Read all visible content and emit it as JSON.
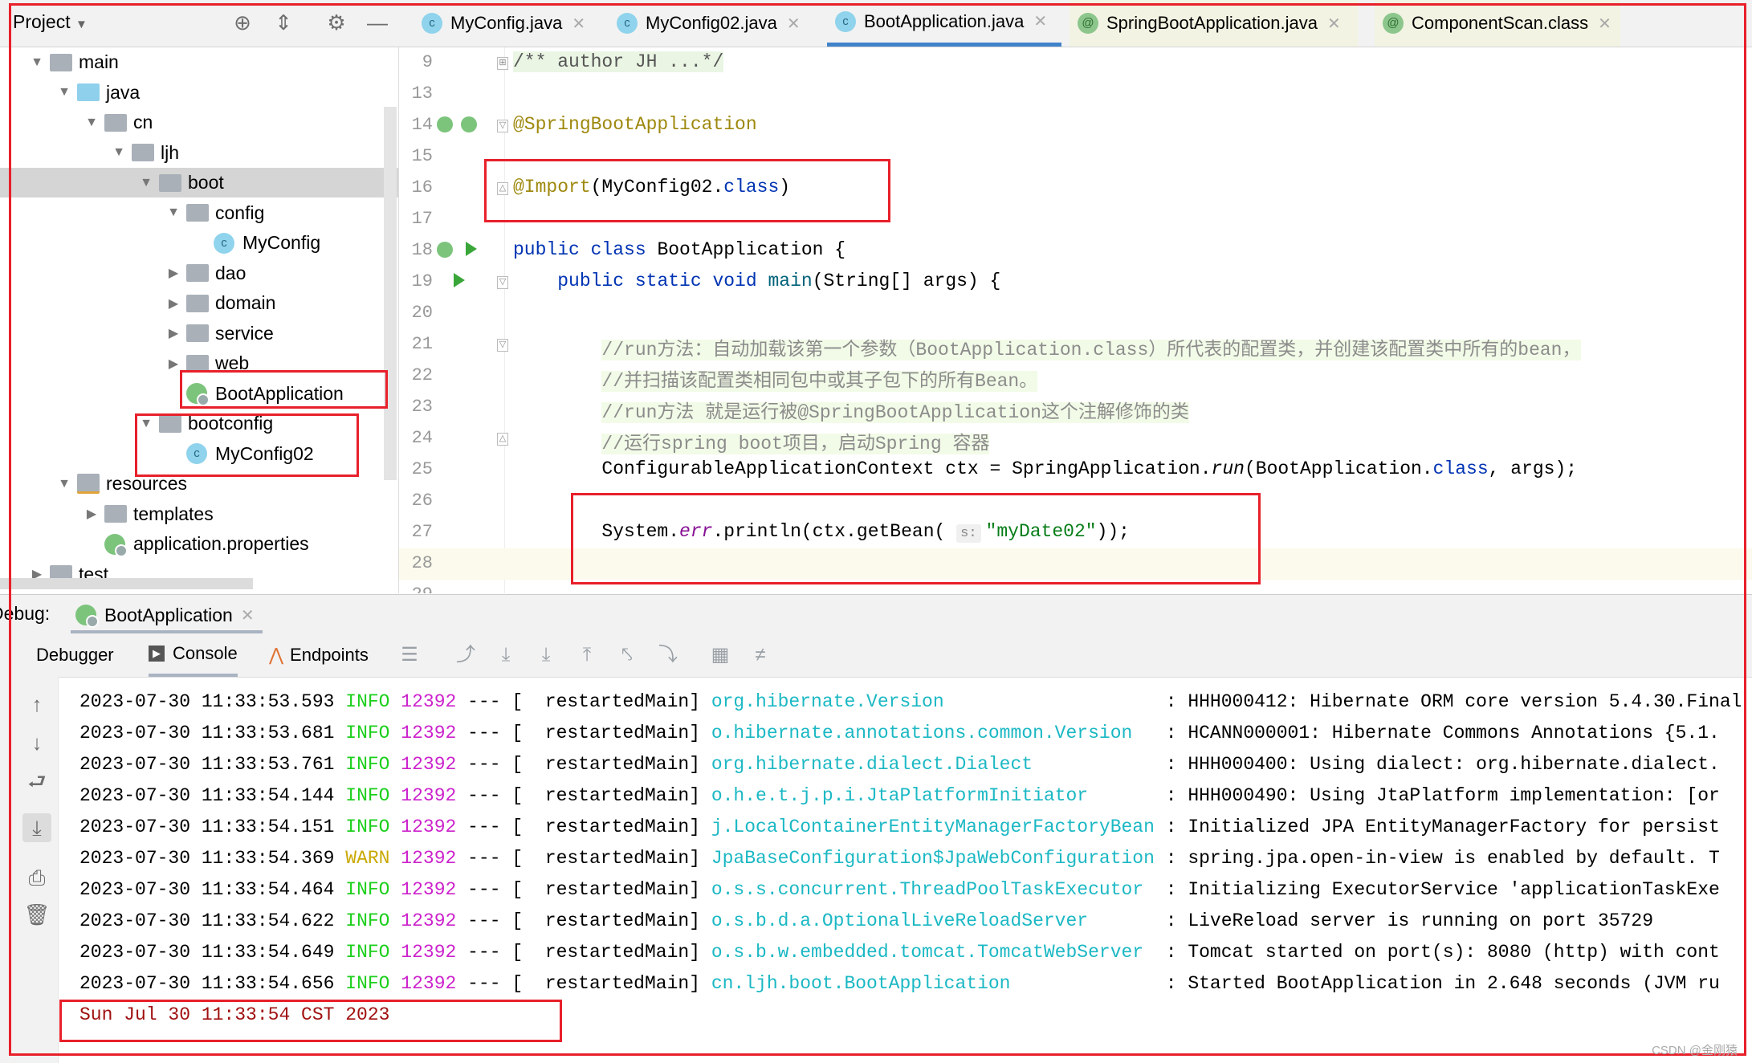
{
  "project_panel": {
    "title": "Project",
    "header_icons": [
      "locate-icon",
      "collapse-all-icon",
      "gear-icon",
      "minimize-icon"
    ],
    "tree": [
      {
        "label": "main",
        "level": 0,
        "type": "folder",
        "expanded": true
      },
      {
        "label": "java",
        "level": 1,
        "type": "source-folder",
        "expanded": true
      },
      {
        "label": "cn",
        "level": 2,
        "type": "package",
        "expanded": true
      },
      {
        "label": "ljh",
        "level": 3,
        "type": "package",
        "expanded": true
      },
      {
        "label": "boot",
        "level": 4,
        "type": "package",
        "expanded": true,
        "selected": true
      },
      {
        "label": "config",
        "level": 5,
        "type": "package",
        "expanded": true
      },
      {
        "label": "MyConfig",
        "level": 6,
        "type": "class"
      },
      {
        "label": "dao",
        "level": 5,
        "type": "package",
        "expanded": false
      },
      {
        "label": "domain",
        "level": 5,
        "type": "package",
        "expanded": false
      },
      {
        "label": "service",
        "level": 5,
        "type": "package",
        "expanded": false
      },
      {
        "label": "web",
        "level": 5,
        "type": "package",
        "expanded": false
      },
      {
        "label": "BootApplication",
        "level": 5,
        "type": "spring-class"
      },
      {
        "label": "bootconfig",
        "level": 4,
        "type": "package",
        "expanded": true
      },
      {
        "label": "MyConfig02",
        "level": 5,
        "type": "class"
      },
      {
        "label": "resources",
        "level": 1,
        "type": "resource-folder",
        "expanded": true
      },
      {
        "label": "templates",
        "level": 2,
        "type": "folder",
        "expanded": false
      },
      {
        "label": "application.properties",
        "level": 2,
        "type": "properties"
      },
      {
        "label": "test",
        "level": 0,
        "type": "folder",
        "expanded": false
      }
    ]
  },
  "editor_tabs": [
    {
      "label": "MyConfig.java",
      "icon": "class-icon"
    },
    {
      "label": "MyConfig02.java",
      "icon": "class-icon"
    },
    {
      "label": "BootApplication.java",
      "icon": "spring-class-icon",
      "active": true
    },
    {
      "label": "SpringBootApplication.java",
      "icon": "annotation-icon"
    },
    {
      "label": "ComponentScan.class",
      "icon": "annotation-icon"
    }
  ],
  "code_lines": [
    {
      "n": "9",
      "tokens": [
        {
          "k": "doc",
          "t": "/** author JH ...*/"
        }
      ]
    },
    {
      "n": "13",
      "tokens": []
    },
    {
      "n": "14",
      "tokens": [
        {
          "k": "ann",
          "t": "@SpringBootApplication"
        }
      ]
    },
    {
      "n": "15",
      "tokens": []
    },
    {
      "n": "16",
      "tokens": [
        {
          "k": "ann",
          "t": "@Import"
        },
        {
          "k": "p",
          "t": "(MyConfig02."
        },
        {
          "k": "kw",
          "t": "class"
        },
        {
          "k": "p",
          "t": ")"
        }
      ]
    },
    {
      "n": "17",
      "tokens": []
    },
    {
      "n": "18",
      "tokens": [
        {
          "k": "kw",
          "t": "public class "
        },
        {
          "k": "p",
          "t": "BootApplication {"
        }
      ]
    },
    {
      "n": "19",
      "tokens": [
        {
          "k": "p",
          "t": "    "
        },
        {
          "k": "kw",
          "t": "public static void "
        },
        {
          "k": "fn",
          "t": "main"
        },
        {
          "k": "p",
          "t": "(String[] args) {"
        }
      ]
    },
    {
      "n": "20",
      "tokens": []
    },
    {
      "n": "21",
      "tokens": [
        {
          "k": "p",
          "t": "        "
        },
        {
          "k": "cm",
          "t": "//run方法：自动加载该第一个参数（BootApplication.class）所代表的配置类，并创建该配置类中所有的bean，"
        }
      ]
    },
    {
      "n": "22",
      "tokens": [
        {
          "k": "p",
          "t": "        "
        },
        {
          "k": "cm",
          "t": "//并扫描该配置类相同包中或其子包下的所有Bean。"
        }
      ]
    },
    {
      "n": "23",
      "tokens": [
        {
          "k": "p",
          "t": "        "
        },
        {
          "k": "cm",
          "t": "//run方法 就是运行被@SpringBootApplication这个注解修饰的类"
        }
      ]
    },
    {
      "n": "24",
      "tokens": [
        {
          "k": "p",
          "t": "        "
        },
        {
          "k": "cm",
          "t": "//运行spring boot项目，启动Spring 容器"
        }
      ]
    },
    {
      "n": "25",
      "tokens": [
        {
          "k": "p",
          "t": "        ConfigurableApplicationContext ctx = SpringApplication."
        },
        {
          "k": "it",
          "t": "run"
        },
        {
          "k": "p",
          "t": "(BootApplication."
        },
        {
          "k": "kw",
          "t": "class"
        },
        {
          "k": "p",
          "t": ", args);"
        }
      ]
    },
    {
      "n": "26",
      "tokens": []
    },
    {
      "n": "27",
      "tokens": [
        {
          "k": "p",
          "t": "        System."
        },
        {
          "k": "field",
          "t": "err"
        },
        {
          "k": "p",
          "t": ".println(ctx.getBean( "
        },
        {
          "k": "hint",
          "t": "s:"
        },
        {
          "k": "str",
          "t": "\"myDate02\""
        },
        {
          "k": "p",
          "t": "));"
        }
      ]
    },
    {
      "n": "28",
      "tokens": [],
      "current": true
    },
    {
      "n": "29",
      "tokens": []
    }
  ],
  "debug": {
    "label": "Debug:",
    "run_tab": "BootApplication",
    "tabs": [
      {
        "label": "Debugger"
      },
      {
        "label": "Console",
        "active": true
      },
      {
        "label": "Endpoints"
      }
    ],
    "toolbar_icons": [
      "threads-icon",
      "show-execution-point-icon",
      "step-over-icon",
      "step-into-icon",
      "step-out-icon",
      "drop-frame-icon",
      "run-to-cursor-icon",
      "evaluate-icon",
      "trace-icon"
    ],
    "side_icons": [
      "scroll-up-icon",
      "scroll-down-icon",
      "soft-wrap-icon",
      "scroll-to-end-icon",
      "print-icon",
      "clear-icon"
    ]
  },
  "console": {
    "thread": "restartedMain",
    "separator": "---",
    "rows": [
      {
        "ts": "2023-07-30 11:33:53.593",
        "level": "INFO",
        "pid": "12392",
        "logger": "org.hibernate.Version",
        "msg": "HHH000412: Hibernate ORM core version 5.4.30.Final"
      },
      {
        "ts": "2023-07-30 11:33:53.681",
        "level": "INFO",
        "pid": "12392",
        "logger": "o.hibernate.annotations.common.Version",
        "msg": "HCANN000001: Hibernate Commons Annotations {5.1."
      },
      {
        "ts": "2023-07-30 11:33:53.761",
        "level": "INFO",
        "pid": "12392",
        "logger": "org.hibernate.dialect.Dialect",
        "msg": "HHH000400: Using dialect: org.hibernate.dialect."
      },
      {
        "ts": "2023-07-30 11:33:54.144",
        "level": "INFO",
        "pid": "12392",
        "logger": "o.h.e.t.j.p.i.JtaPlatformInitiator",
        "msg": "HHH000490: Using JtaPlatform implementation: [or"
      },
      {
        "ts": "2023-07-30 11:33:54.151",
        "level": "INFO",
        "pid": "12392",
        "logger": "j.LocalContainerEntityManagerFactoryBean",
        "msg": "Initialized JPA EntityManagerFactory for persist"
      },
      {
        "ts": "2023-07-30 11:33:54.369",
        "level": "WARN",
        "pid": "12392",
        "logger": "JpaBaseConfiguration$JpaWebConfiguration",
        "msg": "spring.jpa.open-in-view is enabled by default. T"
      },
      {
        "ts": "2023-07-30 11:33:54.464",
        "level": "INFO",
        "pid": "12392",
        "logger": "o.s.s.concurrent.ThreadPoolTaskExecutor",
        "msg": "Initializing ExecutorService 'applicationTaskExe"
      },
      {
        "ts": "2023-07-30 11:33:54.622",
        "level": "INFO",
        "pid": "12392",
        "logger": "o.s.b.d.a.OptionalLiveReloadServer",
        "msg": "LiveReload server is running on port 35729"
      },
      {
        "ts": "2023-07-30 11:33:54.649",
        "level": "INFO",
        "pid": "12392",
        "logger": "o.s.b.w.embedded.tomcat.TomcatWebServer",
        "msg": "Tomcat started on port(s): 8080 (http) with cont"
      },
      {
        "ts": "2023-07-30 11:33:54.656",
        "level": "INFO",
        "pid": "12392",
        "logger": "cn.ljh.boot.BootApplication",
        "msg": "Started BootApplication in 2.648 seconds (JVM ru"
      }
    ],
    "stderr_output": "Sun Jul 30 11:33:54 CST 2023"
  },
  "watermark": "CSDN @金刚猿",
  "colors": {
    "annotation_box": "#e8202a",
    "active_tab": "#4083c9",
    "info": "#1ccf1c",
    "warn": "#c9a800",
    "pid": "#cc22cc",
    "logger": "#1bb8c4"
  }
}
